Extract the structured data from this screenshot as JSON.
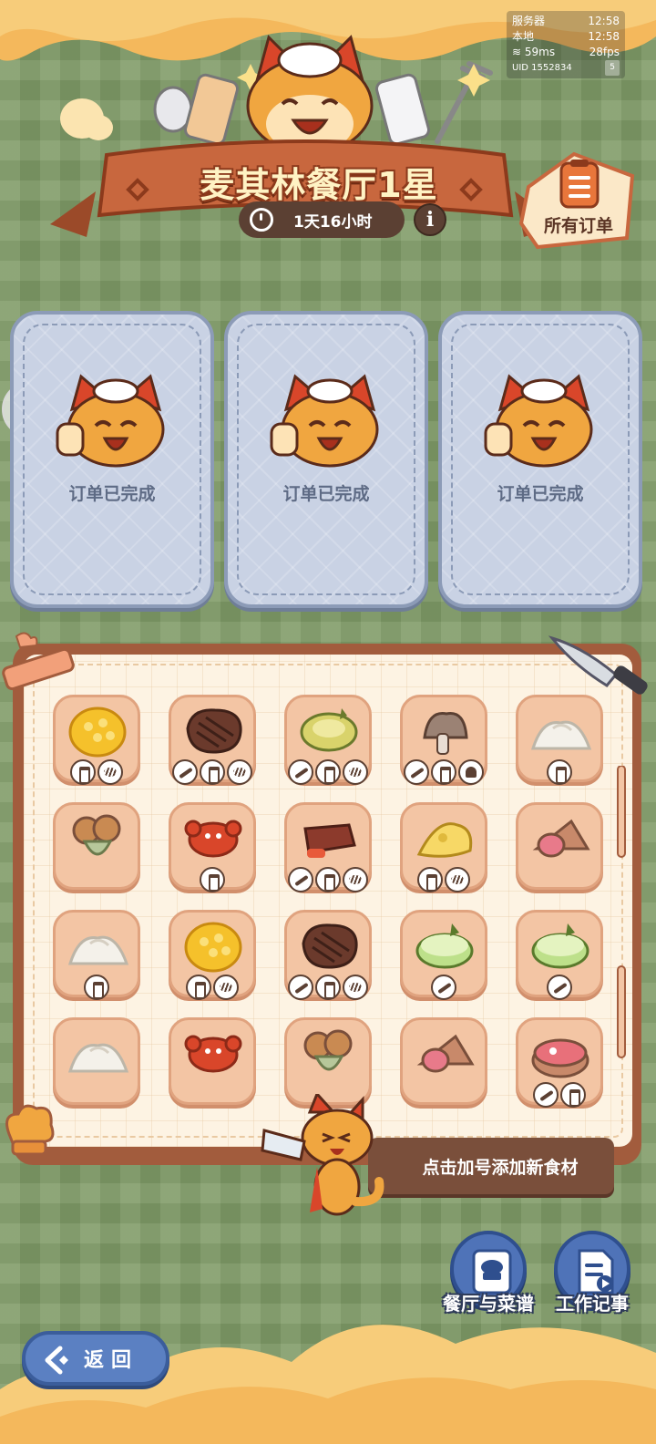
{
  "status": {
    "server_label": "服务器",
    "server_time": "12:58",
    "local_label": "本地",
    "local_time": "12:58",
    "ping": "59ms",
    "fps": "28fps",
    "uid_label": "UID",
    "uid": "1552834",
    "badge": "5"
  },
  "header": {
    "title": "麦其林餐厅1星",
    "timer": "1天16小时",
    "info": "i",
    "orders_button": "所有订单"
  },
  "orders": [
    {
      "status": "订单已完成"
    },
    {
      "status": "订单已完成"
    },
    {
      "status": "订单已完成"
    }
  ],
  "ingredients": [
    {
      "icon": "corn",
      "tags": [
        "shaker",
        "grill"
      ]
    },
    {
      "icon": "steak",
      "tags": [
        "knife",
        "shaker",
        "grill"
      ]
    },
    {
      "icon": "zucchini-slices",
      "tags": [
        "knife",
        "shaker",
        "grill"
      ]
    },
    {
      "icon": "mushrooms",
      "tags": [
        "knife",
        "shaker",
        "muffin"
      ]
    },
    {
      "icon": "flour",
      "tags": [
        "shaker"
      ]
    },
    {
      "icon": "broccoli",
      "tags": []
    },
    {
      "icon": "crab",
      "tags": [
        "shaker"
      ]
    },
    {
      "icon": "ribs",
      "tags": [
        "knife",
        "shaker",
        "grill"
      ]
    },
    {
      "icon": "cheese",
      "tags": [
        "shaker",
        "grill"
      ]
    },
    {
      "icon": "ham",
      "tags": []
    },
    {
      "icon": "flour",
      "tags": [
        "shaker"
      ]
    },
    {
      "icon": "corn",
      "tags": [
        "shaker",
        "grill"
      ]
    },
    {
      "icon": "steak",
      "tags": [
        "knife",
        "shaker",
        "grill"
      ]
    },
    {
      "icon": "zucchini",
      "tags": [
        "knife"
      ]
    },
    {
      "icon": "zucchini",
      "tags": [
        "knife"
      ]
    },
    {
      "icon": "flour",
      "tags": []
    },
    {
      "icon": "crab",
      "tags": []
    },
    {
      "icon": "broccoli",
      "tags": []
    },
    {
      "icon": "ham",
      "tags": []
    },
    {
      "icon": "ham-slice",
      "tags": [
        "knife",
        "shaker"
      ]
    }
  ],
  "hint": "点击加号添加新食材",
  "actions": {
    "recipes": "餐厅与菜谱",
    "journal": "工作记事"
  },
  "back": "返回",
  "colors": {
    "background": "#7f9b67",
    "banner": "#c8673e",
    "card": "#c9d2e4",
    "board": "#a25c3d",
    "button_blue": "#4f73b8"
  }
}
